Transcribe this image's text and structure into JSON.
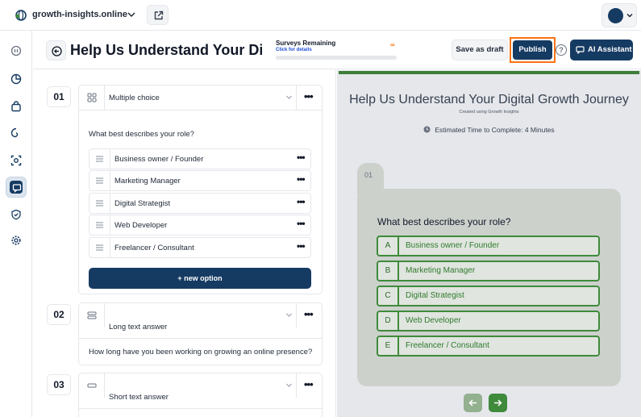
{
  "topbar": {
    "site_name": "growth-insights.online",
    "site_logo_icon": "globe-logo-icon",
    "external_link_icon": "external-link-icon"
  },
  "rail": {
    "items": [
      "timer-icon",
      "pie-chart-icon",
      "bag-icon",
      "spiral-icon",
      "scan-icon",
      "chat-icon",
      "shield-icon",
      "gear-icon"
    ],
    "active_index": 5
  },
  "header": {
    "title": "Help Us Understand Your Digit",
    "surveys_title": "Surveys Remaining",
    "surveys_link": "Click for details",
    "surveys_count": "∞",
    "save_draft_label": "Save as draft",
    "publish_label": "Publish",
    "help_label": "?",
    "ai_label": "AI Assistant"
  },
  "editor": {
    "questions": [
      {
        "number": "01",
        "type": "Multiple choice",
        "text": "What best describes your role?",
        "options": [
          "Business owner / Founder",
          "Marketing Manager",
          "Digital Strategist",
          "Web Developer",
          "Freelancer / Consultant"
        ],
        "add_option_label": "+ new option"
      },
      {
        "number": "02",
        "type": "Long text answer",
        "text": "How long have you been working on growing an online presence?"
      },
      {
        "number": "03",
        "type": "Short text answer"
      }
    ],
    "more_label": "•••"
  },
  "preview": {
    "title": "Help Us Understand Your Digital Growth Journey",
    "subtitle": "Created using Growth Insights",
    "time_prefix": "Estimated Time to Complete: ",
    "time_value": "4 Minutes",
    "question_number": "01",
    "question_text": "What best describes your role?",
    "options": [
      {
        "letter": "A",
        "label": "Business owner / Founder"
      },
      {
        "letter": "B",
        "label": "Marketing Manager"
      },
      {
        "letter": "C",
        "label": "Digital Strategist"
      },
      {
        "letter": "D",
        "label": "Web Developer"
      },
      {
        "letter": "E",
        "label": "Freelancer / Consultant"
      }
    ]
  },
  "colors": {
    "brand_navy": "#163b63",
    "accent_green": "#3f8a3b",
    "highlight_orange": "#f97316"
  }
}
